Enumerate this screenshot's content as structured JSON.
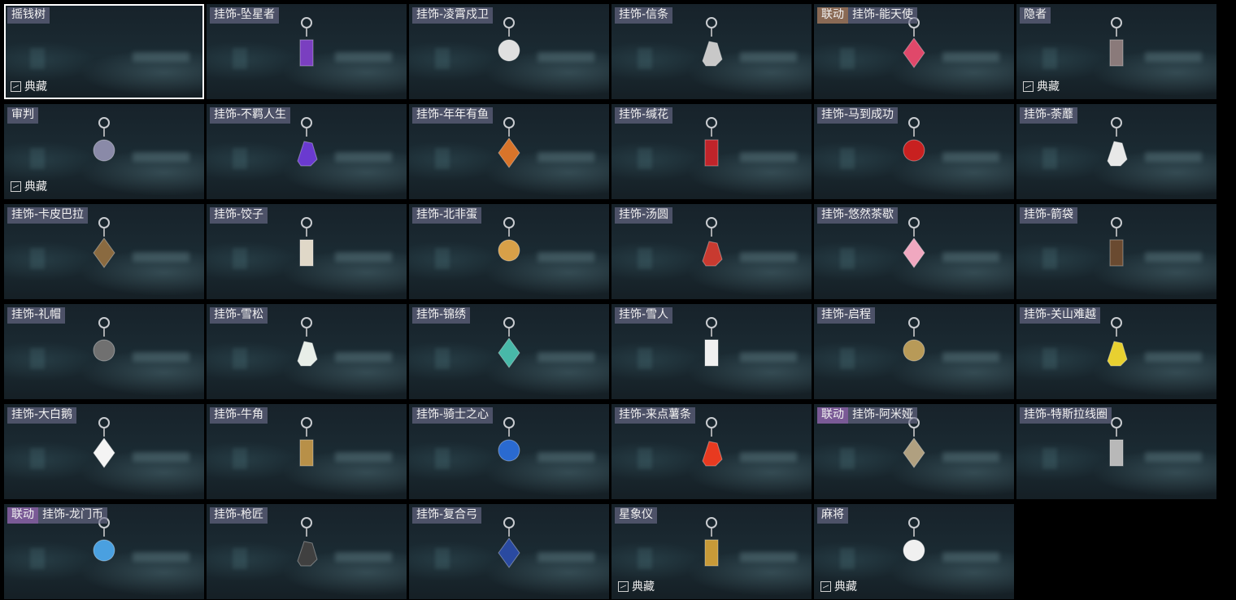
{
  "collect_label": "典藏",
  "items": [
    {
      "name": "摇钱树",
      "collab": "",
      "collect": true,
      "selected": true,
      "color": "#2a3540",
      "icon": "money-tree-icon"
    },
    {
      "name": "挂饰-坠星者",
      "collab": "",
      "collect": false,
      "color": "#7a3fc0",
      "icon": "crystal-charm-icon"
    },
    {
      "name": "挂饰-凌霄戍卫",
      "collab": "",
      "collect": false,
      "color": "#e0e0e0",
      "icon": "rocket-charm-icon"
    },
    {
      "name": "挂饰-信条",
      "collab": "",
      "collect": false,
      "color": "#c8c8c8",
      "icon": "cup-charm-icon"
    },
    {
      "name": "挂饰-能天使",
      "collab": "联动",
      "collab_style": "brown",
      "collect": false,
      "color": "#e0486a",
      "icon": "card-charm-icon"
    },
    {
      "name": "隐者",
      "collab": "",
      "collect": true,
      "color": "#8a7a7a",
      "icon": "hermit-card-icon"
    },
    {
      "name": "审判",
      "collab": "",
      "collect": true,
      "color": "#8a8aa8",
      "icon": "judgement-card-icon"
    },
    {
      "name": "挂饰-不羁人生",
      "collab": "",
      "collect": false,
      "color": "#6a3ad0",
      "icon": "sneaker-charm-icon"
    },
    {
      "name": "挂饰-年年有鱼",
      "collab": "",
      "collect": false,
      "color": "#d8742a",
      "icon": "fish-charm-icon"
    },
    {
      "name": "挂饰-缄花",
      "collab": "",
      "collect": false,
      "color": "#c0242a",
      "icon": "rose-charm-icon"
    },
    {
      "name": "挂饰-马到成功",
      "collab": "",
      "collect": false,
      "color": "#c82020",
      "icon": "horse-charm-icon"
    },
    {
      "name": "挂饰-荼蘼",
      "collab": "",
      "collect": false,
      "color": "#e8e8e8",
      "icon": "flower-charm-icon"
    },
    {
      "name": "挂饰-卡皮巴拉",
      "collab": "",
      "collect": false,
      "color": "#8a6a40",
      "icon": "capybara-charm-icon"
    },
    {
      "name": "挂饰-饺子",
      "collab": "",
      "collect": false,
      "color": "#e0d8c8",
      "icon": "dumpling-charm-icon"
    },
    {
      "name": "挂饰-北非蛋",
      "collab": "",
      "collect": false,
      "color": "#d8a048",
      "icon": "egg-dish-charm-icon"
    },
    {
      "name": "挂饰-汤圆",
      "collab": "",
      "collect": false,
      "color": "#c83a30",
      "icon": "tangyuan-charm-icon"
    },
    {
      "name": "挂饰-悠然茶歇",
      "collab": "",
      "collect": false,
      "color": "#f0a8c0",
      "icon": "cupcake-charm-icon"
    },
    {
      "name": "挂饰-箭袋",
      "collab": "",
      "collect": false,
      "color": "#6a4a30",
      "icon": "quiver-charm-icon"
    },
    {
      "name": "挂饰-礼帽",
      "collab": "",
      "collect": false,
      "color": "#707070",
      "icon": "hat-charm-icon"
    },
    {
      "name": "挂饰-雪松",
      "collab": "",
      "collect": false,
      "color": "#e8eee8",
      "icon": "tree-charm-icon"
    },
    {
      "name": "挂饰-锦绣",
      "collab": "",
      "collect": false,
      "color": "#48b8a8",
      "icon": "butterfly-charm-icon"
    },
    {
      "name": "挂饰-雪人",
      "collab": "",
      "collect": false,
      "color": "#f0f0f0",
      "icon": "snowman-charm-icon"
    },
    {
      "name": "挂饰-启程",
      "collab": "",
      "collect": false,
      "color": "#b89a58",
      "icon": "compass-charm-icon"
    },
    {
      "name": "挂饰-关山难越",
      "collab": "",
      "collect": false,
      "color": "#e8d030",
      "icon": "bottle-charm-icon"
    },
    {
      "name": "挂饰-大白鹅",
      "collab": "",
      "collect": false,
      "color": "#f4f4f4",
      "icon": "goose-charm-icon"
    },
    {
      "name": "挂饰-牛角",
      "collab": "",
      "collect": false,
      "color": "#b89048",
      "icon": "horns-charm-icon"
    },
    {
      "name": "挂饰-骑士之心",
      "collab": "",
      "collect": false,
      "color": "#2a6ad0",
      "icon": "shield-charm-icon"
    },
    {
      "name": "挂饰-来点薯条",
      "collab": "",
      "collect": false,
      "color": "#e83a20",
      "icon": "fries-charm-icon"
    },
    {
      "name": "挂饰-阿米娅",
      "collab": "联动",
      "collab_style": "purple",
      "collect": false,
      "color": "#b0a080",
      "icon": "bunny-charm-icon"
    },
    {
      "name": "挂饰-特斯拉线圈",
      "collab": "",
      "collect": false,
      "color": "#b8b8b8",
      "icon": "coil-charm-icon"
    },
    {
      "name": "挂饰-龙门币",
      "collab": "联动",
      "collab_style": "purple",
      "collect": false,
      "color": "#4aa0e0",
      "icon": "coin-charm-icon"
    },
    {
      "name": "挂饰-枪匠",
      "collab": "",
      "collect": false,
      "color": "#404040",
      "icon": "toolbox-charm-icon"
    },
    {
      "name": "挂饰-复合弓",
      "collab": "",
      "collect": false,
      "color": "#2a4aa0",
      "icon": "bow-charm-icon"
    },
    {
      "name": "星象仪",
      "collab": "",
      "collect": true,
      "color": "#c89a38",
      "icon": "astrolabe-icon"
    },
    {
      "name": "麻将",
      "collab": "",
      "collect": true,
      "color": "#f0f0f0",
      "icon": "mahjong-tile-icon"
    }
  ]
}
